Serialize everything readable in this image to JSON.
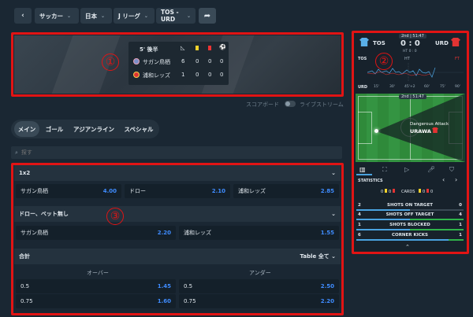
{
  "breadcrumb": {
    "sport": "サッカー",
    "country": "日本",
    "league": "J リーグ",
    "match": "TOS - URD"
  },
  "scoreboard": {
    "period": "5'",
    "period_label": "後半",
    "home": "サガン鳥栖",
    "away": "浦和レッズ",
    "home_stats": [
      "6",
      "0",
      "0",
      "0"
    ],
    "away_stats": [
      "1",
      "0",
      "0",
      "0"
    ]
  },
  "toggle": {
    "score_label": "スコアボード",
    "stream_label": "ライブストリーム"
  },
  "tabs": [
    "メイン",
    "ゴール",
    "アジアンライン",
    "スペシャル"
  ],
  "search": {
    "placeholder": "探す"
  },
  "markets": {
    "m1": {
      "title": "1x2",
      "odds": [
        {
          "label": "サガン鳥栖",
          "value": "4.00"
        },
        {
          "label": "ドロー",
          "value": "2.10"
        },
        {
          "label": "浦和レッズ",
          "value": "2.85"
        }
      ]
    },
    "m2": {
      "title": "ドロー、ベット無し",
      "odds": [
        {
          "label": "サガン鳥栖",
          "value": "2.20"
        },
        {
          "label": "浦和レッズ",
          "value": "1.55"
        }
      ]
    },
    "m3": {
      "title": "合計",
      "table_label": "Table",
      "filter": "全て",
      "over": "オーバー",
      "under": "アンダー",
      "rows": [
        {
          "over_line": "0.5",
          "over_val": "1.45",
          "under_line": "0.5",
          "under_val": "2.50"
        },
        {
          "over_line": "0.75",
          "over_val": "1.60",
          "under_line": "0.75",
          "under_val": "2.20"
        }
      ]
    }
  },
  "annotations": [
    "①",
    "②",
    "③"
  ],
  "panel": {
    "home": "TOS",
    "away": "URD",
    "time": "2nd | 51:47",
    "score": "0 : 0",
    "ht": "HT 0 : 0",
    "timeline_labels": [
      "TOS",
      "HT",
      "FT"
    ],
    "timeline_ticks": [
      "URD",
      "15'",
      "30'",
      "45'+2",
      "60'",
      "75'",
      "90'"
    ],
    "field_time": "2nd | 51:47",
    "attack": "Dangerous Attack",
    "attack_team": "URAWA",
    "statistics_label": "STATISTICS",
    "cards_label": "CARDS",
    "cards_home": [
      "0",
      "0"
    ],
    "cards_away": [
      "0",
      "0"
    ],
    "stats": [
      {
        "home": "2",
        "label": "SHOTS ON TARGET",
        "away": "0"
      },
      {
        "home": "4",
        "label": "SHOTS OFF TARGET",
        "away": "4"
      },
      {
        "home": "1",
        "label": "SHOTS BLOCKED",
        "away": "1"
      },
      {
        "home": "6",
        "label": "CORNER KICKS",
        "away": "1"
      }
    ]
  },
  "colors": {
    "accent": "#3f8cff",
    "home": "#4aa3e0",
    "away": "#e23333",
    "annotation": "#e11414"
  }
}
